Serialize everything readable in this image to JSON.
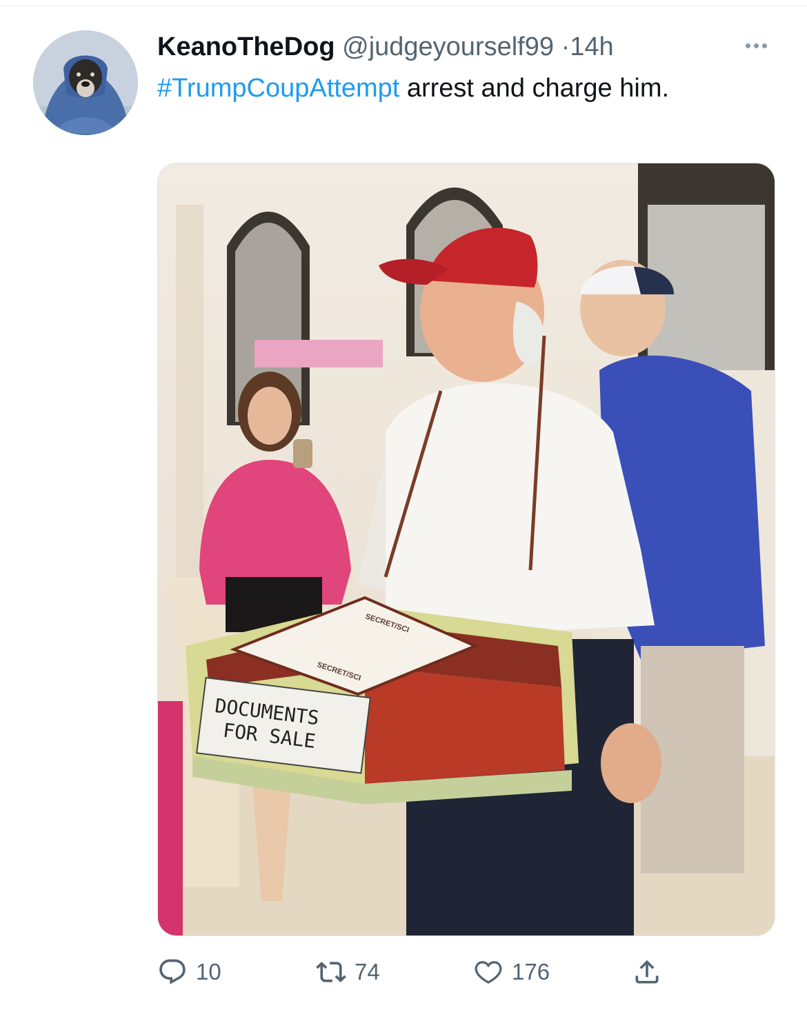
{
  "tweet": {
    "author_name": "KeanoTheDog",
    "handle": "@judgeyourself99",
    "separator": "·",
    "time": "14h",
    "hashtag": "#TrumpCoupAttempt",
    "text": " arrest and charge him.",
    "avatar_icon": "dog-avatar-image",
    "more_icon": "more-options-icon"
  },
  "media": {
    "box_label_line1": "DOCUMENTS",
    "box_label_line2": "FOR SALE",
    "document_stamp_1": "SECRET/SCI",
    "document_stamp_2": "SECRET/SCI"
  },
  "actions": {
    "reply_count": "10",
    "retweet_count": "74",
    "like_count": "176",
    "reply_icon": "reply-icon",
    "retweet_icon": "retweet-icon",
    "like_icon": "heart-icon",
    "share_icon": "share-icon"
  },
  "colors": {
    "hashtag": "#1d9bf0",
    "secondary_text": "#536471",
    "hat_red": "#c7252c",
    "shirt_pink": "#e0457b",
    "shirt_blue": "#3b4fb8"
  }
}
